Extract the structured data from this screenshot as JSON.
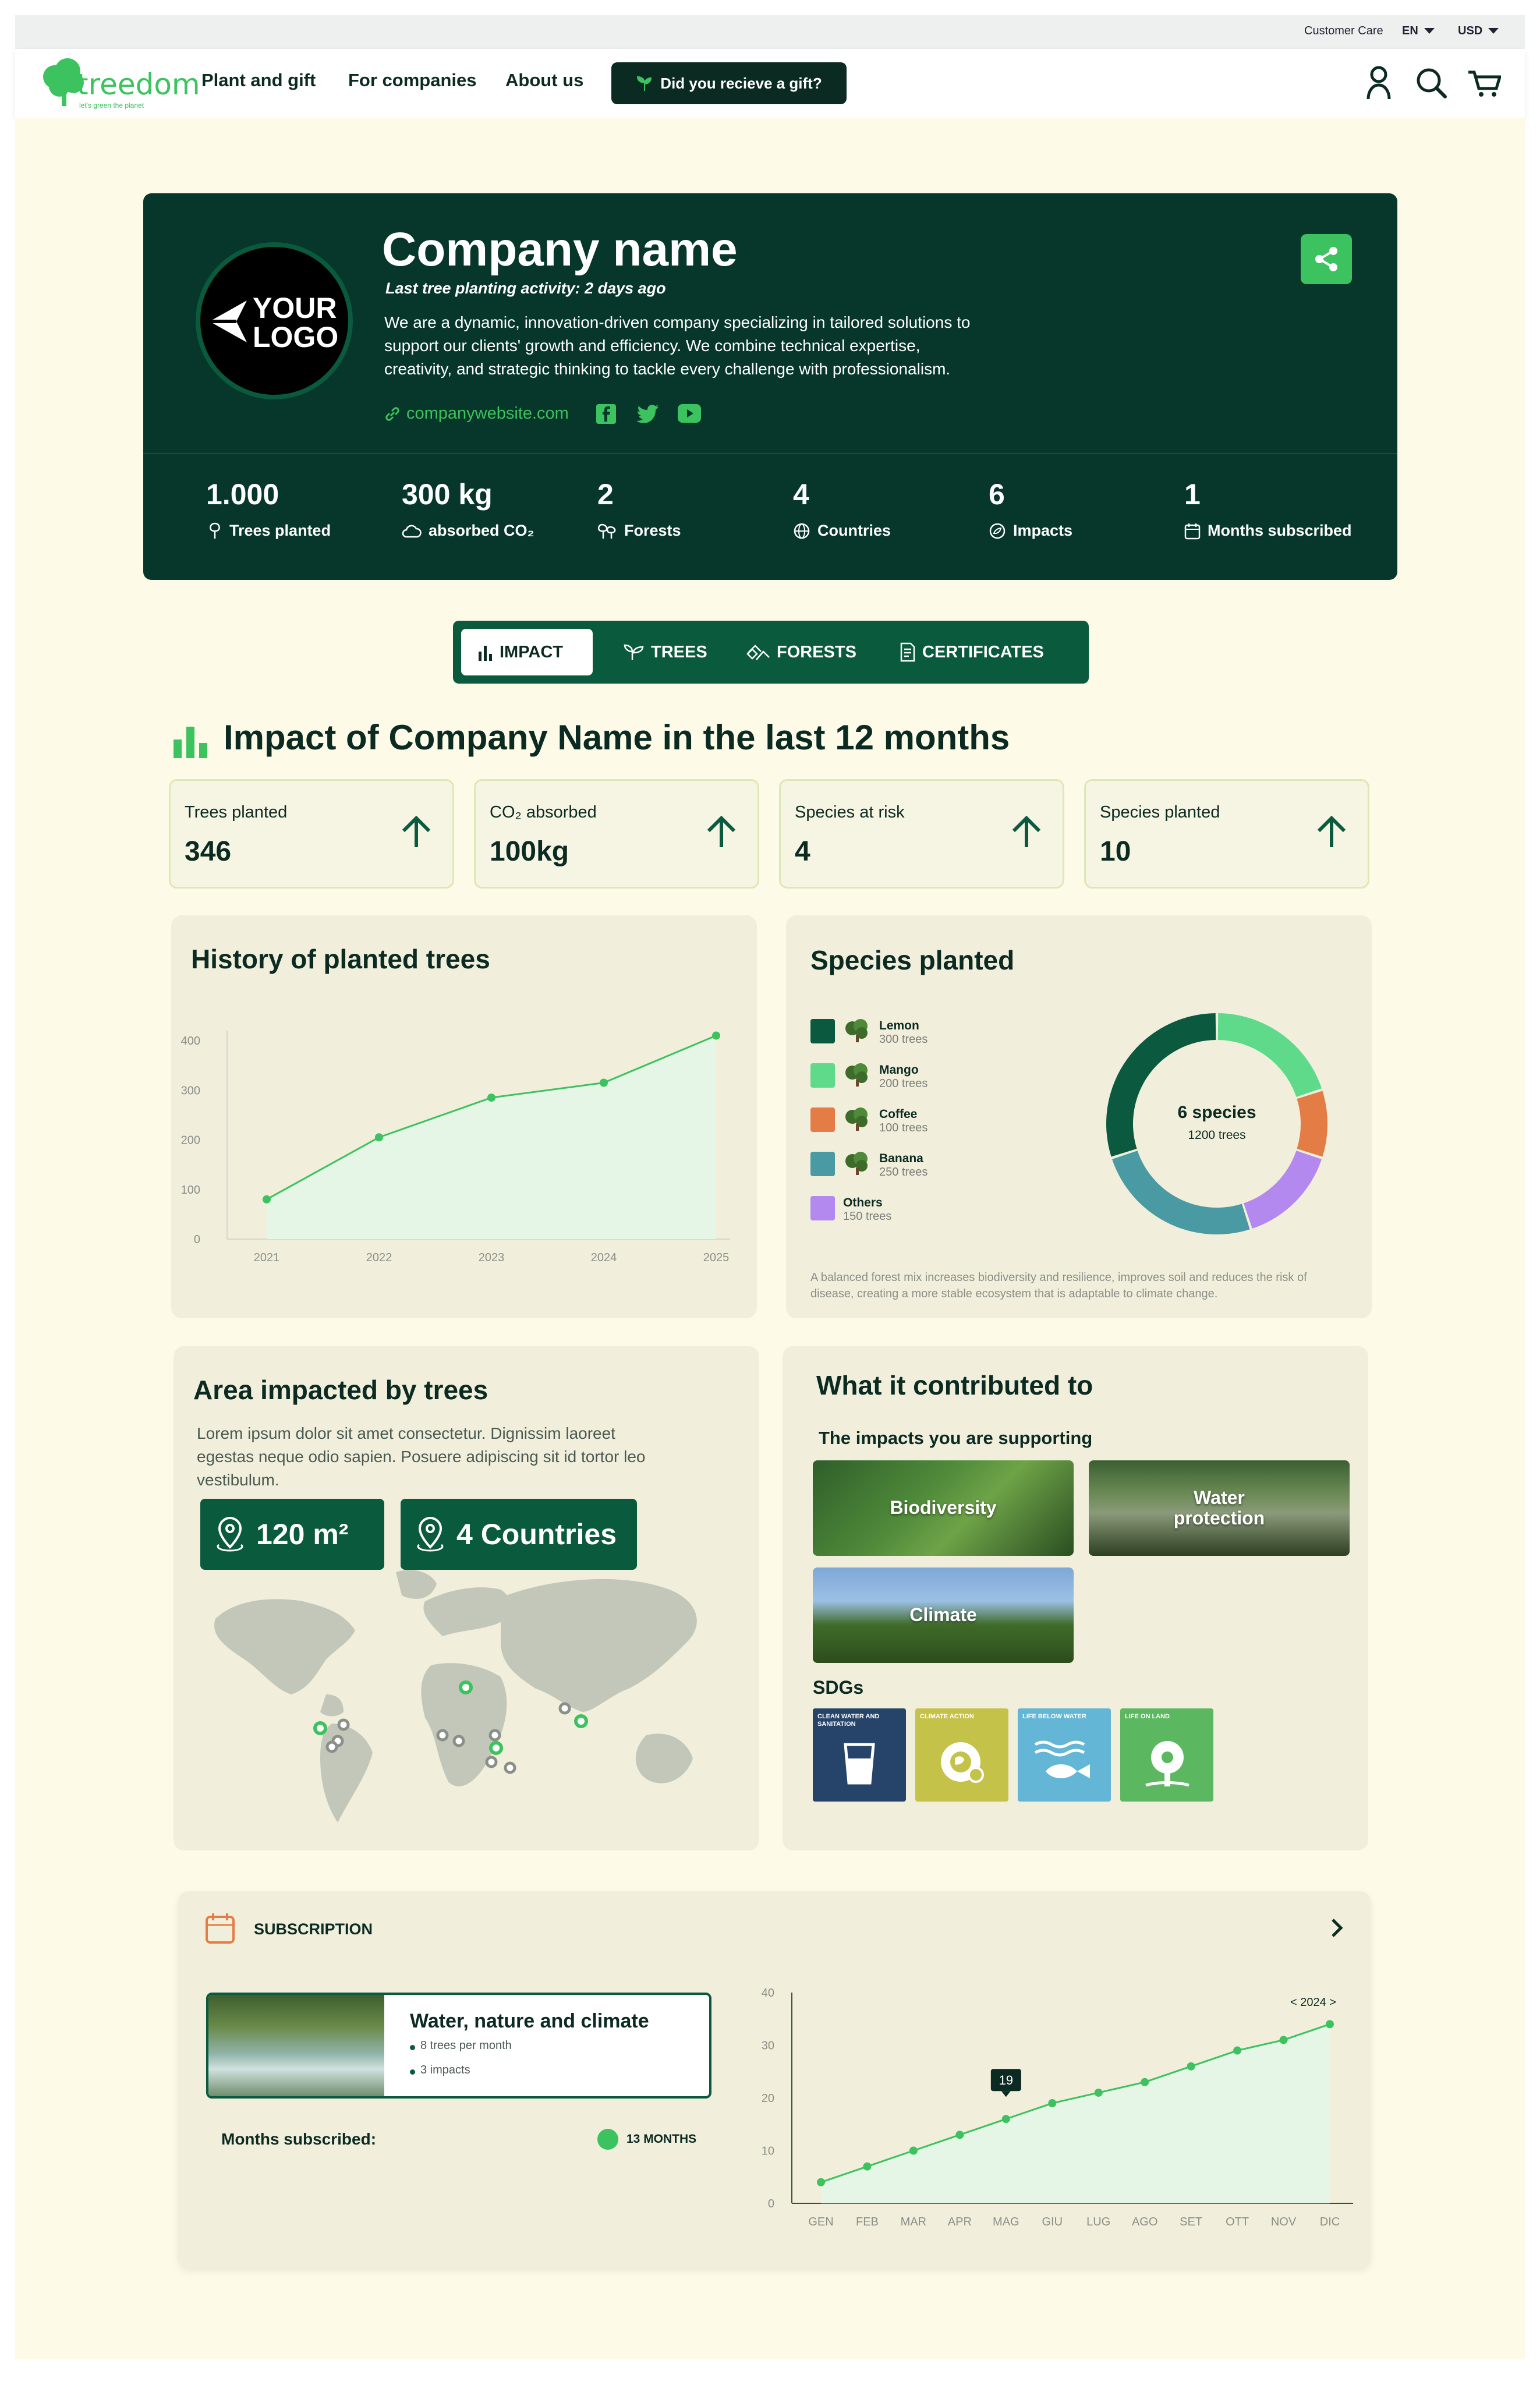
{
  "topbar": {
    "customer_care": "Customer Care",
    "language": "EN",
    "currency": "USD"
  },
  "brand": {
    "name": "treedom",
    "tagline": "let's green the planet"
  },
  "nav": {
    "items": [
      "Plant and gift",
      "For companies",
      "About us"
    ],
    "gift_button": "Did you recieve a gift?"
  },
  "company": {
    "logo_line1": "YOUR",
    "logo_line2": "LOGO",
    "name": "Company name",
    "last_activity": "Last tree planting activity:  2 days ago",
    "description": "We are a dynamic, innovation-driven company specializing in tailored solutions to support our clients' growth and efficiency. We combine technical expertise, creativity, and strategic thinking to tackle every challenge with professionalism.",
    "website": "companywebsite.com"
  },
  "stats": [
    {
      "value": "1.000",
      "label": "Trees planted",
      "icon": "tree-icon"
    },
    {
      "value": "300 kg",
      "label": "absorbed CO₂",
      "icon": "cloud-icon"
    },
    {
      "value": "2",
      "label": "Forests",
      "icon": "forest-icon"
    },
    {
      "value": "4",
      "label": "Countries",
      "icon": "globe-icon"
    },
    {
      "value": "6",
      "label": "Impacts",
      "icon": "impact-icon"
    },
    {
      "value": "1",
      "label": "Months subscribed",
      "icon": "calendar-icon"
    }
  ],
  "tabs": [
    "IMPACT",
    "TREES",
    "FORESTS",
    "CERTIFICATES"
  ],
  "impact_title": "Impact of Company Name in the last 12 months",
  "kpis": [
    {
      "label": "Trees planted",
      "value": "346"
    },
    {
      "label": "CO₂ absorbed",
      "value": "100kg"
    },
    {
      "label": "Species at risk",
      "value": "4"
    },
    {
      "label": "Species planted",
      "value": "10"
    }
  ],
  "history": {
    "title": "History of planted trees"
  },
  "species": {
    "title": "Species planted",
    "center_title": "6 species",
    "center_sub": "1200 trees",
    "note": "A balanced forest mix increases biodiversity and resilience, improves soil and reduces the risk of disease, creating a more stable ecosystem that is adaptable to climate change."
  },
  "area": {
    "title": "Area impacted by trees",
    "text": "Lorem ipsum dolor sit amet consectetur. Dignissim laoreet egestas neque odio sapien. Posuere adipiscing sit id tortor leo vestibulum.",
    "area_value": "120 m²",
    "countries_value": "4 Countries"
  },
  "contrib": {
    "title": "What it contributed to",
    "subtitle": "The impacts you are supporting",
    "impacts": [
      "Biodiversity",
      "Water protection",
      "Climate"
    ],
    "sdg_title": "SDGs",
    "sdgs": [
      "CLEAN WATER AND SANITATION",
      "CLIMATE ACTION",
      "LIFE BELOW WATER",
      "LIFE ON LAND"
    ]
  },
  "subscription": {
    "header": "SUBSCRIPTION",
    "plan_title": "Water, nature and climate",
    "plan_detail1": "8 trees per month",
    "plan_detail2": "3 impacts",
    "months_label": "Months subscribed:",
    "months_value": "13 MONTHS",
    "year_nav": "< 2024 >",
    "tooltip": "19"
  },
  "colors": {
    "dark_green": "#06372a",
    "accent_green": "#3cc25e",
    "bg_cream": "#fdfbe8"
  },
  "chart_data": [
    {
      "type": "area",
      "title": "History of planted trees",
      "x": [
        "2021",
        "2022",
        "2023",
        "2024",
        "2025"
      ],
      "values": [
        80,
        205,
        285,
        315,
        410
      ],
      "yticks": [
        0,
        100,
        200,
        300,
        400
      ],
      "ylim": [
        0,
        420
      ],
      "grid": false
    },
    {
      "type": "pie",
      "title": "Species planted",
      "categories": [
        "Lemon",
        "Mango",
        "Coffee",
        "Banana",
        "Others"
      ],
      "values": [
        300,
        200,
        100,
        250,
        150
      ],
      "counts": [
        "300 trees",
        "200 trees",
        "100 trees",
        "250 trees",
        "150 trees"
      ],
      "colors": [
        "#0b5a3f",
        "#5fd98a",
        "#e37d45",
        "#4a9aa3",
        "#b388ef"
      ]
    },
    {
      "type": "area",
      "categories": [
        "GEN",
        "FEB",
        "MAR",
        "APR",
        "MAG",
        "GIU",
        "LUG",
        "AGO",
        "SET",
        "OTT",
        "NOV",
        "DIC"
      ],
      "values": [
        4,
        7,
        10,
        13,
        16,
        19,
        21,
        23,
        26,
        29,
        31,
        34
      ],
      "yticks": [
        0,
        10,
        20,
        30,
        40
      ],
      "ylim": [
        0,
        40
      ],
      "grid": false
    }
  ]
}
